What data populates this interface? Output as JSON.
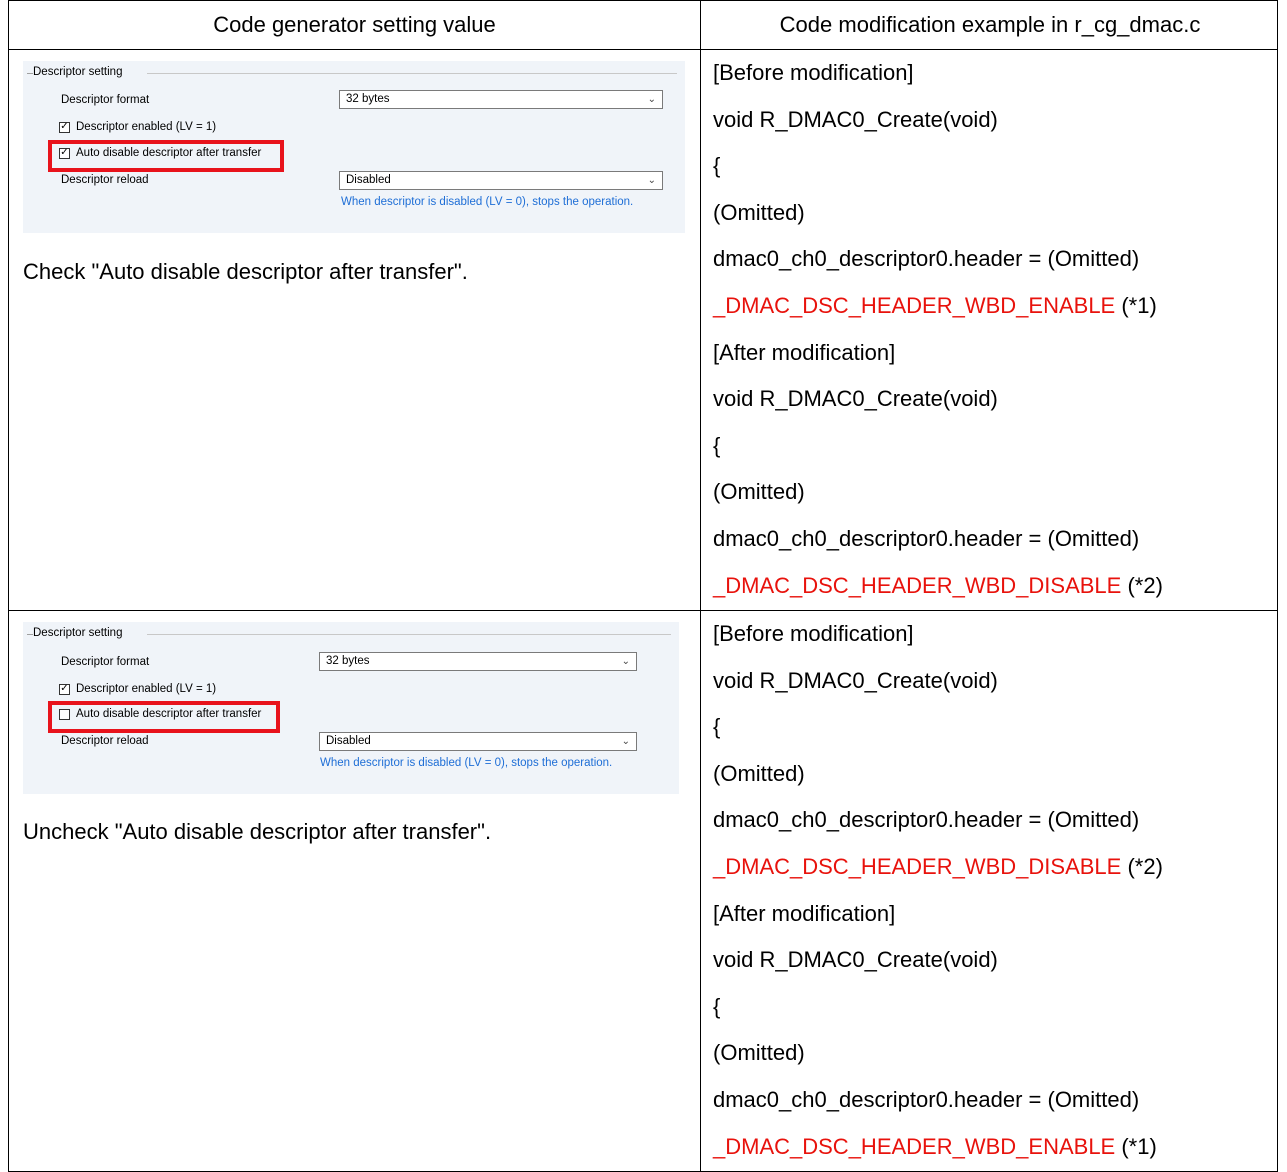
{
  "header": {
    "left": "Code generator setting value",
    "right": "Code modification example in r_cg_dmac.c"
  },
  "dialogs": [
    {
      "group_title": "Descriptor setting",
      "format_label": "Descriptor format",
      "format_value": "32 bytes",
      "enabled_label": "Descriptor enabled (LV = 1)",
      "enabled_checked": true,
      "auto_label": "Auto disable descriptor after transfer",
      "auto_checked": true,
      "reload_label": "Descriptor reload",
      "reload_value": "Disabled",
      "hint": "When descriptor is disabled (LV = 0), stops the operation.",
      "icons": [
        "checkbox-checked-icon",
        "chevron-down-icon"
      ],
      "highlight_color": "#e8131c"
    },
    {
      "group_title": "Descriptor setting",
      "format_label": "Descriptor format",
      "format_value": "32 bytes",
      "enabled_label": "Descriptor enabled (LV = 1)",
      "enabled_checked": true,
      "auto_label": "Auto disable descriptor after transfer",
      "auto_checked": false,
      "reload_label": "Descriptor reload",
      "reload_value": "Disabled",
      "hint": "When descriptor is disabled (LV = 0), stops the operation.",
      "icons": [
        "checkbox-unchecked-icon",
        "chevron-down-icon"
      ],
      "highlight_color": "#e8131c"
    }
  ],
  "rows": [
    {
      "caption": "Check \"Auto disable descriptor after transfer\".",
      "before_label": "[Before modification]",
      "after_label": "[After modification]",
      "func": "void R_DMAC0_Create(void)",
      "brace": "{",
      "omitted": "(Omitted)",
      "assign": "dmac0_ch0_descriptor0.header = (Omitted)",
      "before_macro": "_DMAC_DSC_HEADER_WBD_ENABLE",
      "before_note": " (*1)",
      "after_macro": "_DMAC_DSC_HEADER_WBD_DISABLE",
      "after_note": " (*2)"
    },
    {
      "caption": "Uncheck \"Auto disable descriptor after transfer\".",
      "before_label": "[Before modification]",
      "after_label": "[After modification]",
      "func": "void R_DMAC0_Create(void)",
      "brace": "{",
      "omitted": "(Omitted)",
      "assign": "dmac0_ch0_descriptor0.header = (Omitted)",
      "before_macro": "_DMAC_DSC_HEADER_WBD_DISABLE",
      "before_note": " (*2)",
      "after_macro": "_DMAC_DSC_HEADER_WBD_ENABLE",
      "after_note": " (*1)"
    }
  ],
  "colors": {
    "macro": "#e8120c",
    "hint": "#1e6ed6"
  }
}
